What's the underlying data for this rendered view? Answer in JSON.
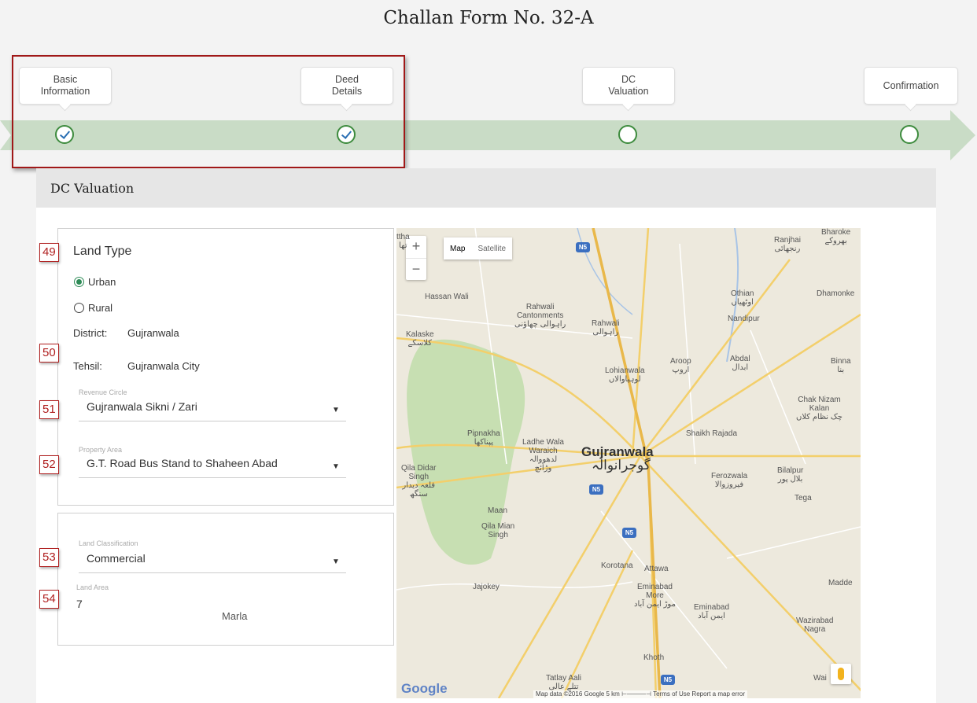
{
  "page": {
    "title": "Challan Form No. 32-A"
  },
  "steps": [
    {
      "label_line1": "Basic",
      "label_line2": "Information",
      "done": true
    },
    {
      "label_line1": "Deed",
      "label_line2": "Details",
      "done": true
    },
    {
      "label_line1": "DC",
      "label_line2": "Valuation",
      "done": false
    },
    {
      "label_line1": "Confirmation",
      "label_line2": "",
      "done": false
    }
  ],
  "section": {
    "title": "DC Valuation"
  },
  "form": {
    "tags": [
      "49",
      "50",
      "51",
      "52",
      "53",
      "54"
    ],
    "land_type": {
      "label": "Land Type",
      "options": [
        "Urban",
        "Rural"
      ],
      "selected": "Urban"
    },
    "district": {
      "label": "District:",
      "value": "Gujranwala"
    },
    "tehsil": {
      "label": "Tehsil:",
      "value": "Gujranwala City"
    },
    "revenue_circle": {
      "label": "Revenue Circle",
      "value": "Gujranwala Sikni / Zari"
    },
    "property_area": {
      "label": "Property Area",
      "value": "G.T. Road Bus Stand to Shaheen Abad"
    },
    "land_classification": {
      "label": "Land Classification",
      "value": "Commercial"
    },
    "land_area": {
      "label": "Land Area",
      "value": "7",
      "unit": "Marla"
    }
  },
  "map": {
    "zoom_in": "+",
    "zoom_out": "−",
    "type_map": "Map",
    "type_satellite": "Satellite",
    "logo": "Google",
    "footer": "Map data ©2016 Google   5 km ⊢———⊣   Terms of Use   Report a map error",
    "highway_badge": "N5",
    "labels": {
      "city": "Gujranwala",
      "city_ur": "گوجرانوالہ",
      "hassan_wali": "Hassan Wali",
      "rahwali_cant": "Rahwali\nCantonments\nراہوالی چھاؤنی",
      "rahwali": "Rahwali\nراہوالی",
      "kalaske": "Kalaske\nکلاسکے",
      "othian": "Othian\nاوٹھیاں",
      "nandipur": "Nandipur",
      "dhamonke": "Dhamonke",
      "ranjhai": "Ranjhai\nرنجھائی",
      "bharoke": "Bharoke\nبھروکے",
      "aroop": "Aroop\nاروپ",
      "abdal": "Abdal\nابدال",
      "binna": "Binna\nبنا",
      "lohianwala": "Lohianwala\nلوہیاوالاں",
      "chak_nizam": "Chak Nizam\nKalan\nچک نظام کلاں",
      "shaikh_rajada": "Shaikh Rajada",
      "pipnakha": "Pipnakha\nپپناکھا",
      "ladhe_wala": "Ladhe Wala\nWaraich\nلدھووالہ\nوڑائچ",
      "qila_didar": "Qila Didar\nSingh\nقلعہ دیدار\nسنگھ",
      "ferozwala": "Ferozwala\nفیروزوالا",
      "bilalpur": "Bilalpur\nبلال پور",
      "tega": "Tega",
      "maan": "Maan",
      "qila_mian": "Qila Mian\nSingh",
      "korotana": "Korotana",
      "attawa": "Attawa",
      "jajokey": "Jajokey",
      "eminabad_more": "Eminabad\nMore\nموڑ ایمن آباد",
      "eminabad": "Eminabad\nایمن آباد",
      "madde": "Madde",
      "wazirabad": "Wazirabad\nNagra",
      "khoth": "Khoth",
      "tatlay": "Tatlay Aali\nتتلے عالی",
      "wai": "Wai",
      "attha": "ttha\nتھا"
    }
  }
}
